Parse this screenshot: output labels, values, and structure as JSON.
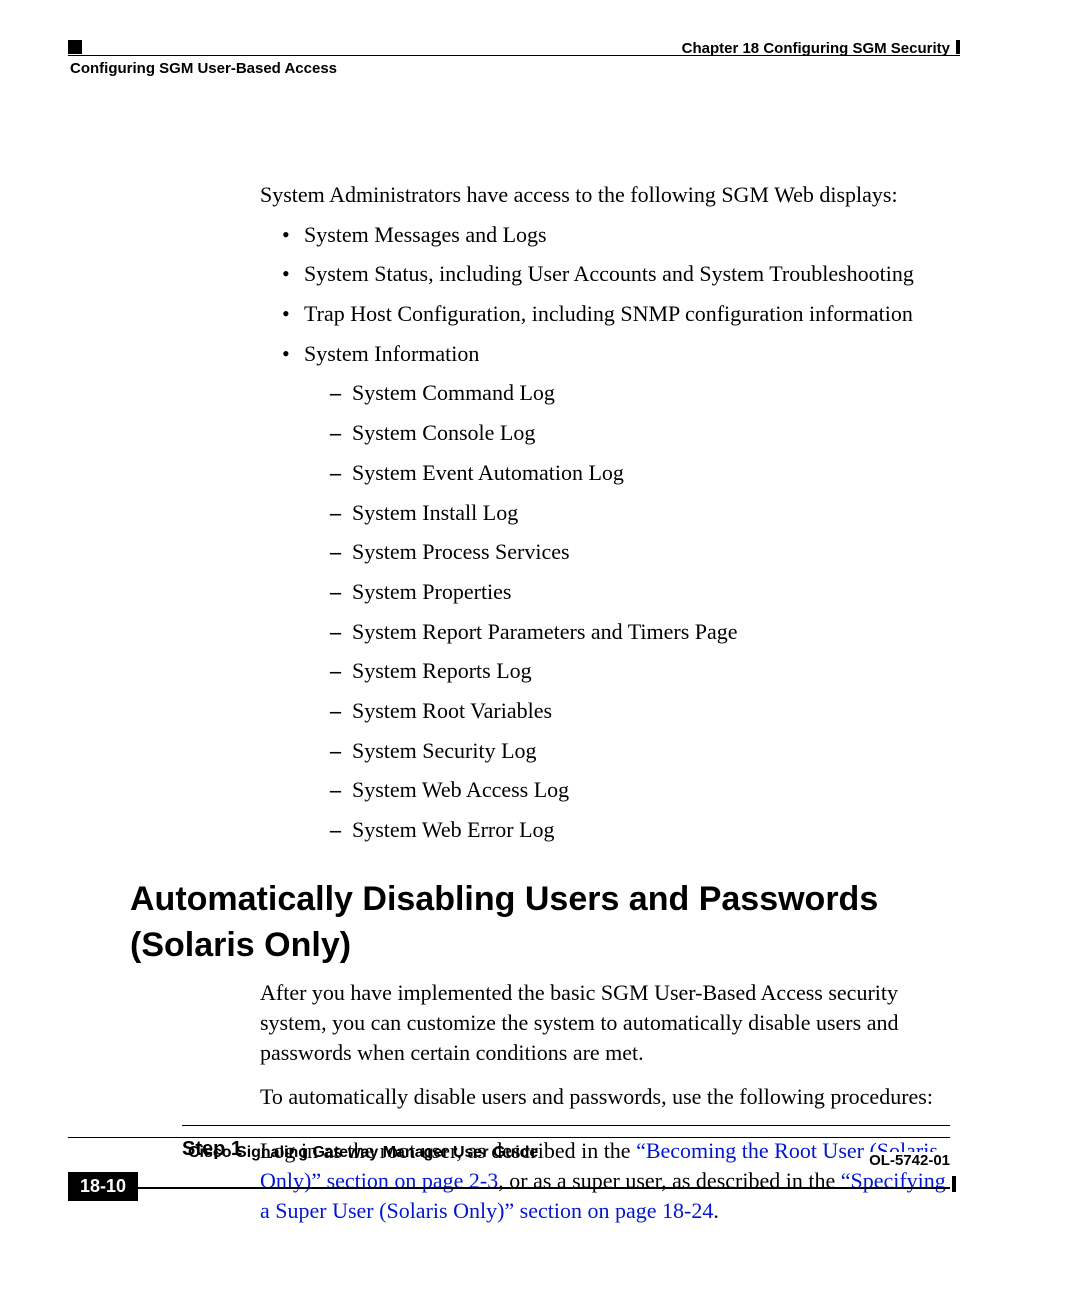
{
  "header": {
    "chapter": "Chapter 18    Configuring SGM Security",
    "section": "Configuring SGM User-Based Access"
  },
  "body": {
    "intro": "System Administrators have access to the following SGM Web displays:",
    "bullets": [
      "System Messages and Logs",
      "System Status, including User Accounts and System Troubleshooting",
      "Trap Host Configuration, including SNMP configuration information",
      "System Information"
    ],
    "sub_bullets": [
      "System Command Log",
      "System Console Log",
      "System Event Automation Log",
      "System Install Log",
      "System Process Services",
      "System Properties",
      "System Report Parameters and Timers Page",
      "System Reports Log",
      "System Root Variables",
      "System Security Log",
      "System Web Access Log",
      "System Web Error Log"
    ]
  },
  "section2": {
    "heading": "Automatically Disabling Users and Passwords (Solaris Only)",
    "p1": "After you have implemented the basic SGM User-Based Access security system, you can customize the system to automatically disable users and passwords when certain conditions are met.",
    "p2": "To automatically disable users and passwords, use the following procedures:",
    "step_label": "Step 1",
    "step_text_a": "Log in as the root user, as described in the ",
    "step_link_a": "“Becoming the Root User (Solaris Only)” section on page 2-3",
    "step_text_b": ", or as a super user, as described in the ",
    "step_link_b": "“Specifying a Super User (Solaris Only)” section on page 18-24",
    "step_text_c": "."
  },
  "footer": {
    "title": "Cisco Signaling Gateway Manager User Guide",
    "page_num": "18-10",
    "doc_code": "OL-5742-01"
  }
}
